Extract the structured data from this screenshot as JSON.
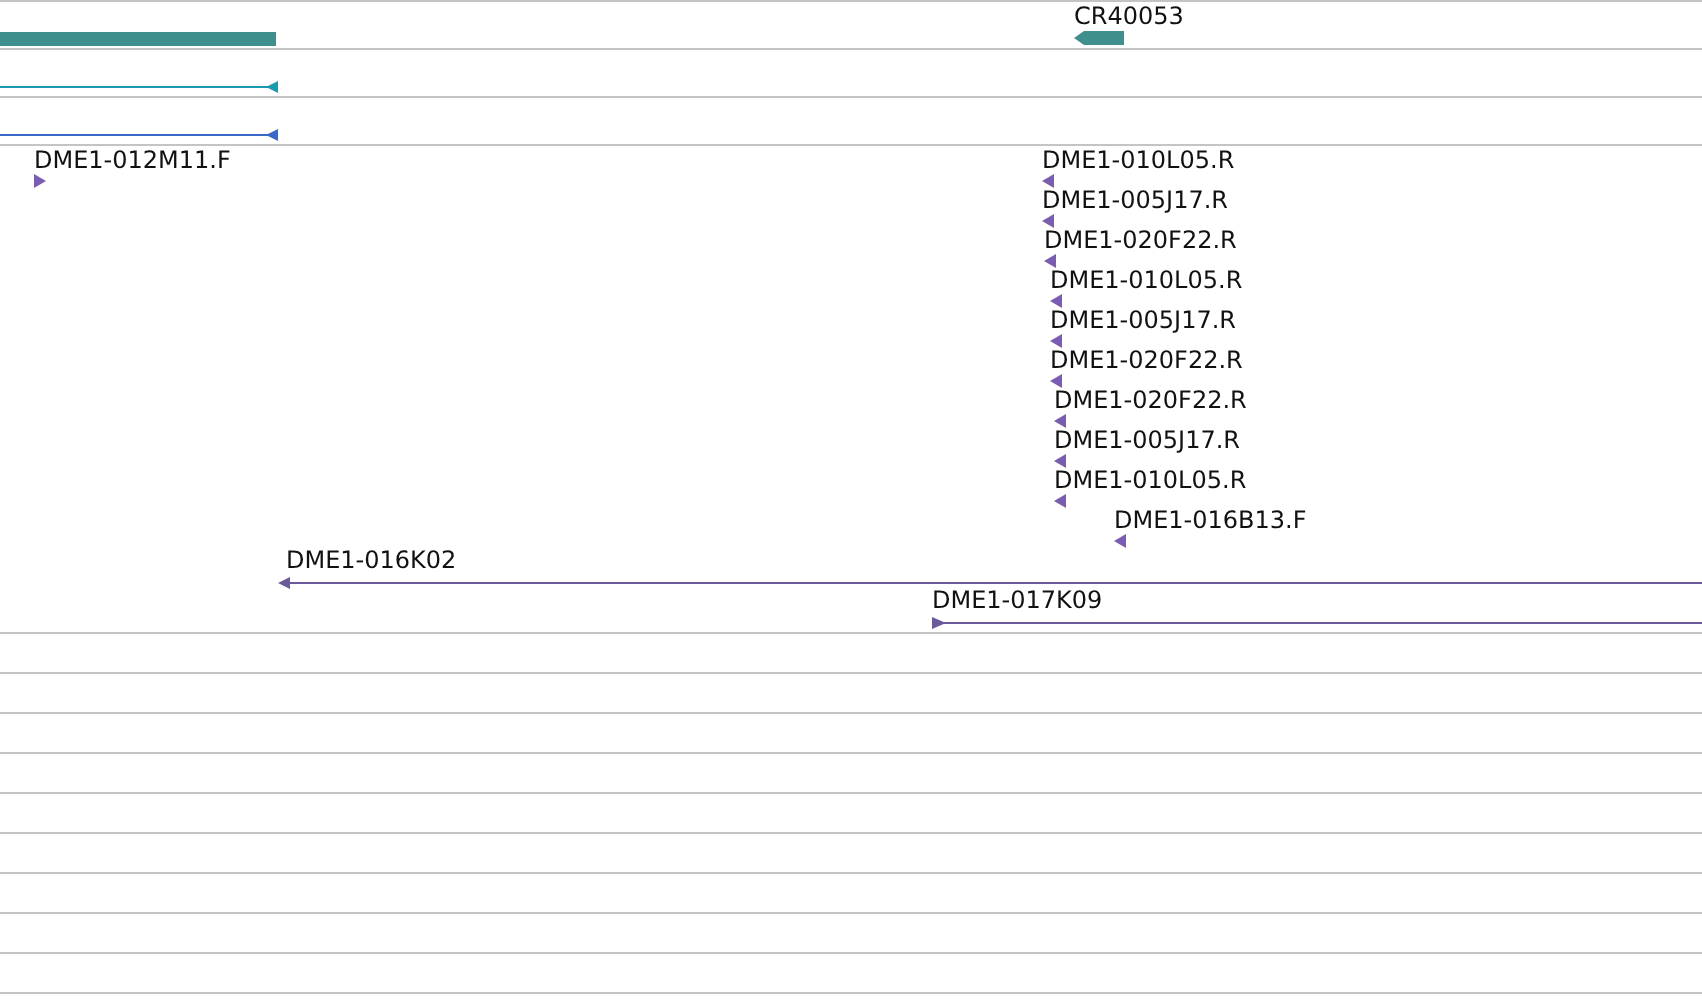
{
  "features": [
    {
      "kind": "block",
      "color": "#3f8f8f"
    },
    {
      "kind": "gene",
      "label": "CR40053",
      "reverse": true,
      "color": "#3f8f8f"
    },
    {
      "kind": "line",
      "reverse": true,
      "color": "#1a9ab0"
    },
    {
      "kind": "line",
      "reverse": true,
      "color": "#3a68c8"
    },
    {
      "kind": "clone",
      "label": "DME1-012M11.F",
      "reverse": false,
      "color": "#7a5cb0"
    },
    {
      "kind": "clone",
      "label": "DME1-010L05.R",
      "reverse": true,
      "color": "#7a5cb0"
    },
    {
      "kind": "clone",
      "label": "DME1-005J17.R",
      "reverse": true,
      "color": "#7a5cb0"
    },
    {
      "kind": "clone",
      "label": "DME1-020F22.R",
      "reverse": true,
      "color": "#7a5cb0"
    },
    {
      "kind": "clone",
      "label": "DME1-010L05.R",
      "reverse": true,
      "color": "#7a5cb0"
    },
    {
      "kind": "clone",
      "label": "DME1-005J17.R",
      "reverse": true,
      "color": "#7a5cb0"
    },
    {
      "kind": "clone",
      "label": "DME1-020F22.R",
      "reverse": true,
      "color": "#7a5cb0"
    },
    {
      "kind": "clone",
      "label": "DME1-020F22.R",
      "reverse": true,
      "color": "#7a5cb0"
    },
    {
      "kind": "clone",
      "label": "DME1-005J17.R",
      "reverse": true,
      "color": "#7a5cb0"
    },
    {
      "kind": "clone",
      "label": "DME1-010L05.R",
      "reverse": true,
      "color": "#7a5cb0"
    },
    {
      "kind": "clone",
      "label": "DME1-016B13.F",
      "reverse": true,
      "color": "#7a5cb0"
    },
    {
      "kind": "line",
      "label": "DME1-016K02",
      "reverse": true,
      "color": "#6a5a9a"
    },
    {
      "kind": "line",
      "label": "DME1-017K09",
      "reverse": false,
      "color": "#6a5a9a"
    }
  ]
}
